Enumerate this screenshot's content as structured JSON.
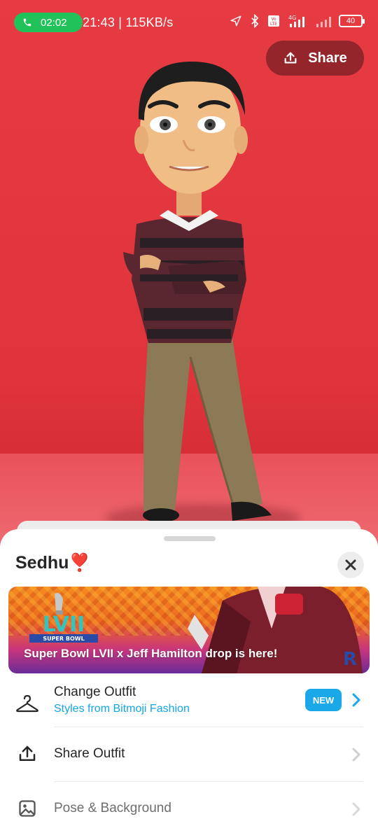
{
  "status_bar": {
    "call_duration": "02:02",
    "time_speed": "21:43 | 115KB/s",
    "battery_level": "40",
    "icons": [
      "phone-icon",
      "location-arrow-icon",
      "bluetooth-icon",
      "volte-icon",
      "signal-4g-icon",
      "signal-weak-icon",
      "battery-icon"
    ]
  },
  "header": {
    "share_label": "Share"
  },
  "sheet": {
    "title": "Sedhu❣️",
    "banner": {
      "text": "Super Bowl LVII x Jeff Hamilton drop is here!",
      "logo_text": "LVII",
      "logo_sub": "SUPER BOWL"
    },
    "items": [
      {
        "label": "Change Outfit",
        "subtitle": "Styles from Bitmoji Fashion",
        "badge": "NEW",
        "icon": "hanger-icon"
      },
      {
        "label": "Share Outfit",
        "icon": "share-upload-icon"
      },
      {
        "label": "Pose & Background",
        "icon": "image-icon"
      }
    ]
  },
  "colors": {
    "background_red": "#e0343c",
    "accent_blue": "#1aa8e8",
    "call_green": "#22c25a"
  }
}
